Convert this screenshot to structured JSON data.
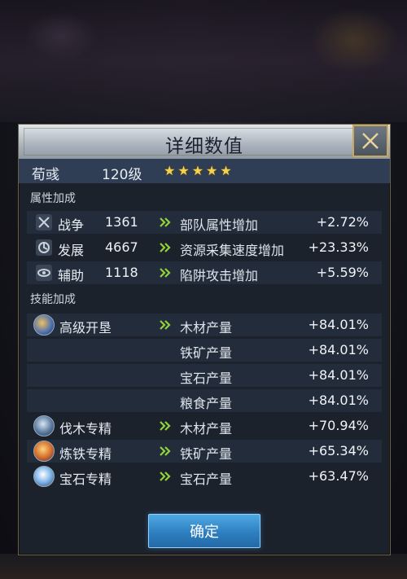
{
  "dialog": {
    "title": "详细数值",
    "close_icon": "close-x-icon",
    "confirm_label": "确定"
  },
  "hero": {
    "name": "荀彧",
    "level": "120级",
    "stars": 5
  },
  "attributes": {
    "header": "属性加成",
    "rows": [
      {
        "icon": "crossed-swords-icon",
        "label": "战争",
        "value": "1361",
        "effect": "部队属性增加",
        "bonus": "+2.72%"
      },
      {
        "icon": "development-icon",
        "label": "发展",
        "value": "4667",
        "effect": "资源采集速度增加",
        "bonus": "+23.33%"
      },
      {
        "icon": "support-icon",
        "label": "辅助",
        "value": "1118",
        "effect": "陷阱攻击增加",
        "bonus": "+5.59%"
      }
    ]
  },
  "skills": {
    "header": "技能加成",
    "rows": [
      {
        "name": "高级开垦",
        "icon": "advanced-cultivation-icon",
        "effect": "木材产量",
        "bonus": "+84.01%"
      },
      {
        "name": "",
        "effect": "铁矿产量",
        "bonus": "+84.01%"
      },
      {
        "name": "",
        "effect": "宝石产量",
        "bonus": "+84.01%"
      },
      {
        "name": "",
        "effect": "粮食产量",
        "bonus": "+84.01%"
      },
      {
        "name": "伐木专精",
        "icon": "logging-mastery-icon",
        "effect": "木材产量",
        "bonus": "+70.94%"
      },
      {
        "name": "炼铁专精",
        "icon": "smelting-mastery-icon",
        "effect": "铁矿产量",
        "bonus": "+65.34%"
      },
      {
        "name": "宝石专精",
        "icon": "gem-mastery-icon",
        "effect": "宝石产量",
        "bonus": "+63.47%"
      }
    ]
  },
  "colors": {
    "star": "#f3d250",
    "arrow": "#8fd43a",
    "accent_gold": "#c9a85b",
    "button_blue": "#2e7fc0"
  }
}
